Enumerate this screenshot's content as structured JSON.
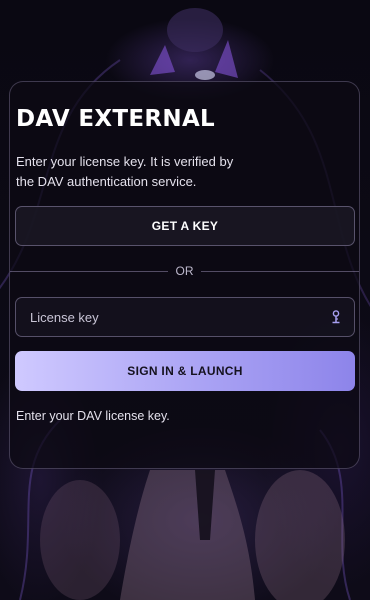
{
  "login": {
    "title": "DAV EXTERNAL",
    "subtitle": "Enter your license key. It is verified by the DAV authentication service.",
    "get_key_label": "GET A KEY",
    "divider_label": "OR",
    "license_field": {
      "placeholder": "License key",
      "value": "",
      "icon": "key-icon"
    },
    "sign_in_label": "SIGN IN & LAUNCH",
    "status_text": "Enter your DAV license key."
  },
  "colors": {
    "accent_gradient_start": "#cfc9ff",
    "accent_gradient_end": "#8d84ea",
    "card_border": "#8f89a8",
    "background": "#07060b"
  }
}
